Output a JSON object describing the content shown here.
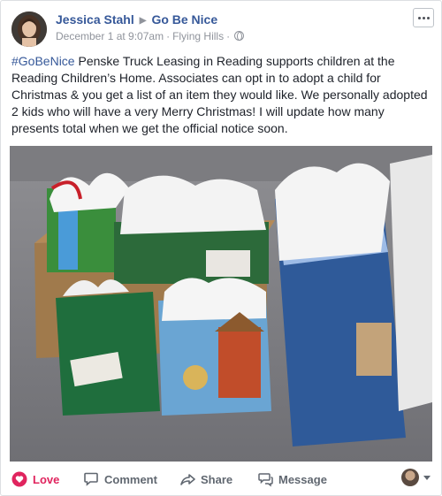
{
  "post": {
    "author": "Jessica Stahl",
    "group": "Go Be Nice",
    "date": "December 1 at 9:07am",
    "location": "Flying Hills",
    "hashtag": "#GoBeNice",
    "body": " Penske Truck Leasing in Reading supports children at the Reading Children’s Home. Associates can opt in to adopt a child for Christmas & you get a list of an item they would like. We personally adopted 2 kids who will have a very Merry Christmas! I will update how many presents total when we get the official notice soon."
  },
  "actions": {
    "love": "Love",
    "comment": "Comment",
    "share": "Share",
    "message": "Message"
  },
  "colors": {
    "link_blue": "#365899",
    "love_red": "#e0245e",
    "meta_gray": "#90949c"
  },
  "icons": [
    "heart-icon",
    "comment-icon",
    "share-icon",
    "message-icon",
    "globe-icon",
    "more-icon"
  ]
}
